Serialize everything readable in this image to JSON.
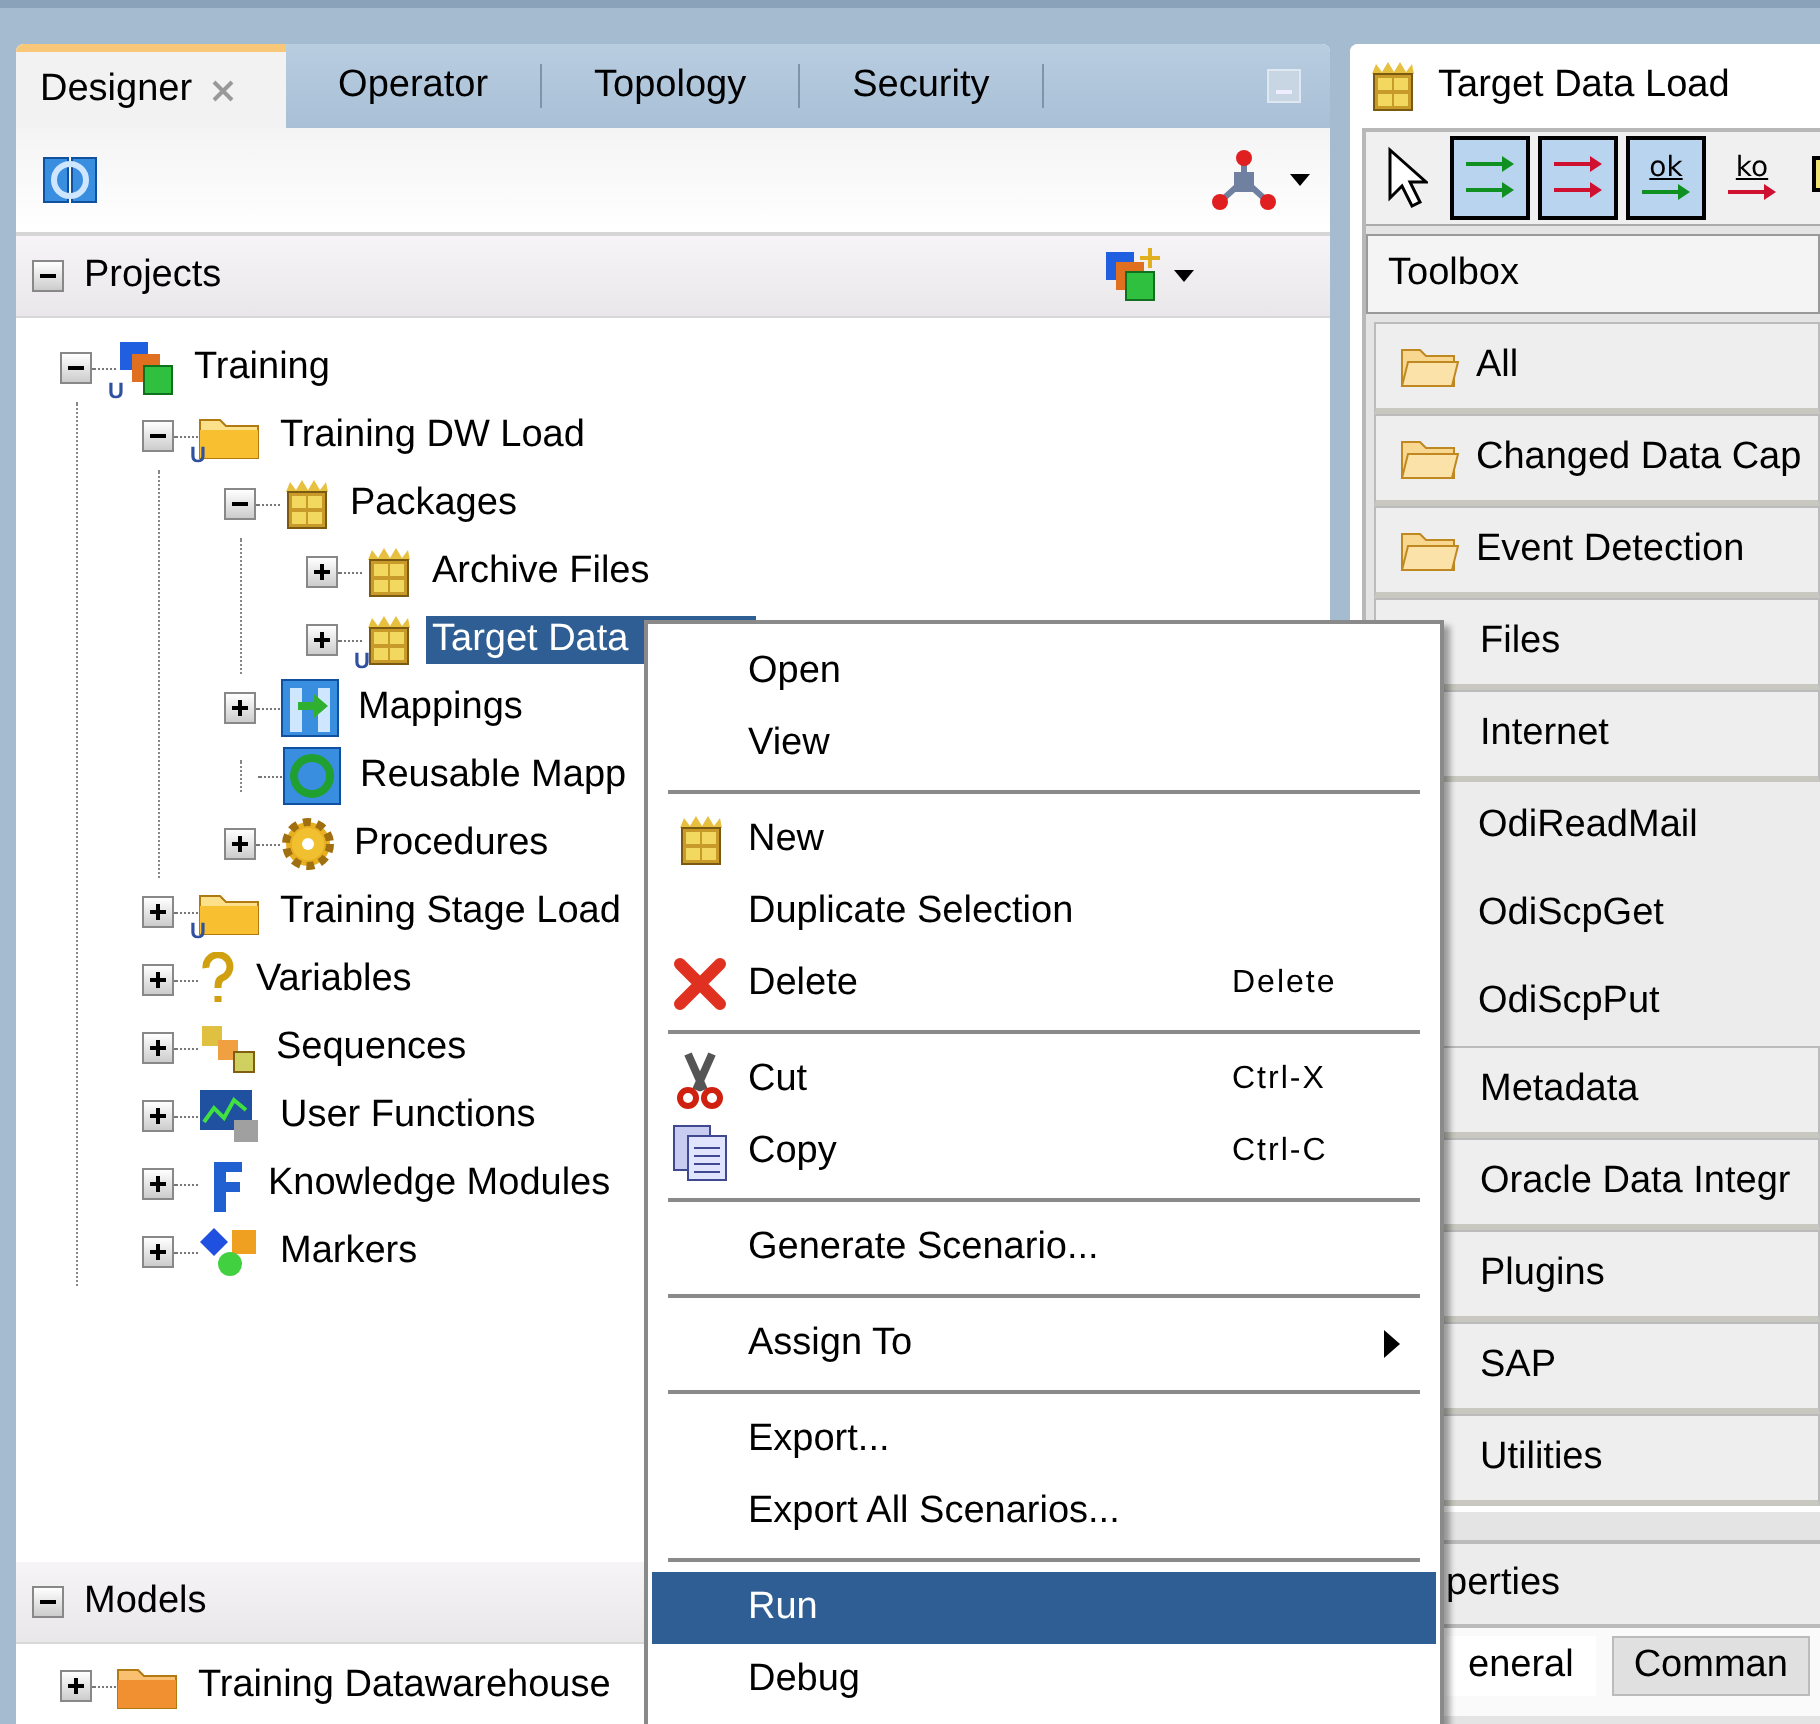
{
  "navigator": {
    "tabs": [
      {
        "label": "Designer",
        "selected": true,
        "closable": true
      },
      {
        "label": "Operator",
        "selected": false,
        "closable": false
      },
      {
        "label": "Topology",
        "selected": false,
        "closable": false
      },
      {
        "label": "Security",
        "selected": false,
        "closable": false
      }
    ],
    "sections": [
      {
        "title": "Projects",
        "expanded": true,
        "tree": [
          {
            "label": "Training",
            "kind": "project",
            "badge": "U",
            "expanded": true,
            "selected": false,
            "children": [
              {
                "label": "Training DW Load",
                "kind": "folder",
                "badge": "U",
                "expanded": true,
                "selected": false,
                "children": [
                  {
                    "label": "Packages",
                    "kind": "package",
                    "expanded": true,
                    "selected": false,
                    "children": [
                      {
                        "label": "Archive Files",
                        "kind": "package",
                        "expanded": false,
                        "selected": false
                      },
                      {
                        "label": "Target Data",
                        "kind": "package",
                        "badge": "U",
                        "expanded": false,
                        "selected": true
                      }
                    ]
                  },
                  {
                    "label": "Mappings",
                    "kind": "mapping",
                    "expanded": false,
                    "selected": false
                  },
                  {
                    "label": "Reusable Mapp",
                    "kind": "reusable",
                    "leaf": true,
                    "selected": false
                  },
                  {
                    "label": "Procedures",
                    "kind": "procedure",
                    "expanded": false,
                    "selected": false
                  }
                ]
              },
              {
                "label": "Training Stage Load",
                "kind": "folder",
                "badge": "U",
                "expanded": false,
                "selected": false
              },
              {
                "label": "Variables",
                "kind": "variable",
                "expanded": false,
                "selected": false
              },
              {
                "label": "Sequences",
                "kind": "sequence",
                "expanded": false,
                "selected": false
              },
              {
                "label": "User Functions",
                "kind": "function",
                "expanded": false,
                "selected": false
              },
              {
                "label": "Knowledge Modules",
                "kind": "km",
                "expanded": false,
                "selected": false
              },
              {
                "label": "Markers",
                "kind": "marker",
                "expanded": false,
                "selected": false
              }
            ]
          }
        ]
      },
      {
        "title": "Models",
        "expanded": true,
        "tree": [
          {
            "label": "Training Datawarehouse",
            "kind": "model-folder",
            "expanded": false,
            "selected": false
          }
        ]
      }
    ]
  },
  "context_menu": {
    "items": [
      {
        "kind": "item",
        "label": "Open",
        "selected": false
      },
      {
        "kind": "item",
        "label": "View",
        "selected": false
      },
      {
        "kind": "separator"
      },
      {
        "kind": "new",
        "label": "New",
        "selected": false
      },
      {
        "kind": "item",
        "label": "Duplicate Selection",
        "selected": false
      },
      {
        "kind": "delete",
        "label": "Delete",
        "shortcut": "Delete",
        "selected": false
      },
      {
        "kind": "separator"
      },
      {
        "kind": "cut",
        "label": "Cut",
        "shortcut": "Ctrl-X",
        "selected": false
      },
      {
        "kind": "copy",
        "label": "Copy",
        "shortcut": "Ctrl-C",
        "selected": false
      },
      {
        "kind": "separator"
      },
      {
        "kind": "item",
        "label": "Generate Scenario...",
        "selected": false
      },
      {
        "kind": "separator"
      },
      {
        "kind": "item",
        "label": "Assign To",
        "submenu": true,
        "selected": false
      },
      {
        "kind": "separator"
      },
      {
        "kind": "item",
        "label": "Export...",
        "selected": false
      },
      {
        "kind": "item",
        "label": "Export All Scenarios...",
        "selected": false
      },
      {
        "kind": "separator"
      },
      {
        "kind": "item",
        "label": "Run",
        "selected": true
      },
      {
        "kind": "item",
        "label": "Debug",
        "selected": false
      }
    ]
  },
  "editor": {
    "tab": {
      "label": "Target Data Load"
    },
    "toolbar": [
      {
        "kind": "pointer",
        "selected": false
      },
      {
        "kind": "ok-flow",
        "selected": true
      },
      {
        "kind": "ko-flow",
        "selected": true
      },
      {
        "kind": "ok-link",
        "label": "ok",
        "selected": true
      },
      {
        "kind": "ko-link",
        "label": "ko",
        "selected": false
      },
      {
        "kind": "note",
        "selected": false
      }
    ],
    "toolbox": {
      "title": "Toolbox",
      "groups": [
        {
          "label": "All",
          "kind": "folder"
        },
        {
          "label": "Changed Data Cap",
          "kind": "folder"
        },
        {
          "label": "Event Detection",
          "kind": "folder"
        },
        {
          "label": "Files",
          "kind": "group"
        },
        {
          "label": "Internet",
          "kind": "group"
        },
        {
          "label": "OdiReadMail",
          "kind": "tool"
        },
        {
          "label": "OdiScpGet",
          "kind": "tool"
        },
        {
          "label": "OdiScpPut",
          "kind": "tool"
        },
        {
          "label": "Metadata",
          "kind": "group"
        },
        {
          "label": "Oracle Data Integr",
          "kind": "group"
        },
        {
          "label": "Plugins",
          "kind": "group"
        },
        {
          "label": "SAP",
          "kind": "group"
        },
        {
          "label": "Utilities",
          "kind": "group"
        }
      ]
    },
    "properties": {
      "title": "perties",
      "tabs": [
        {
          "label": "eneral",
          "selected": true
        },
        {
          "label": "Comman",
          "selected": false
        }
      ]
    }
  }
}
